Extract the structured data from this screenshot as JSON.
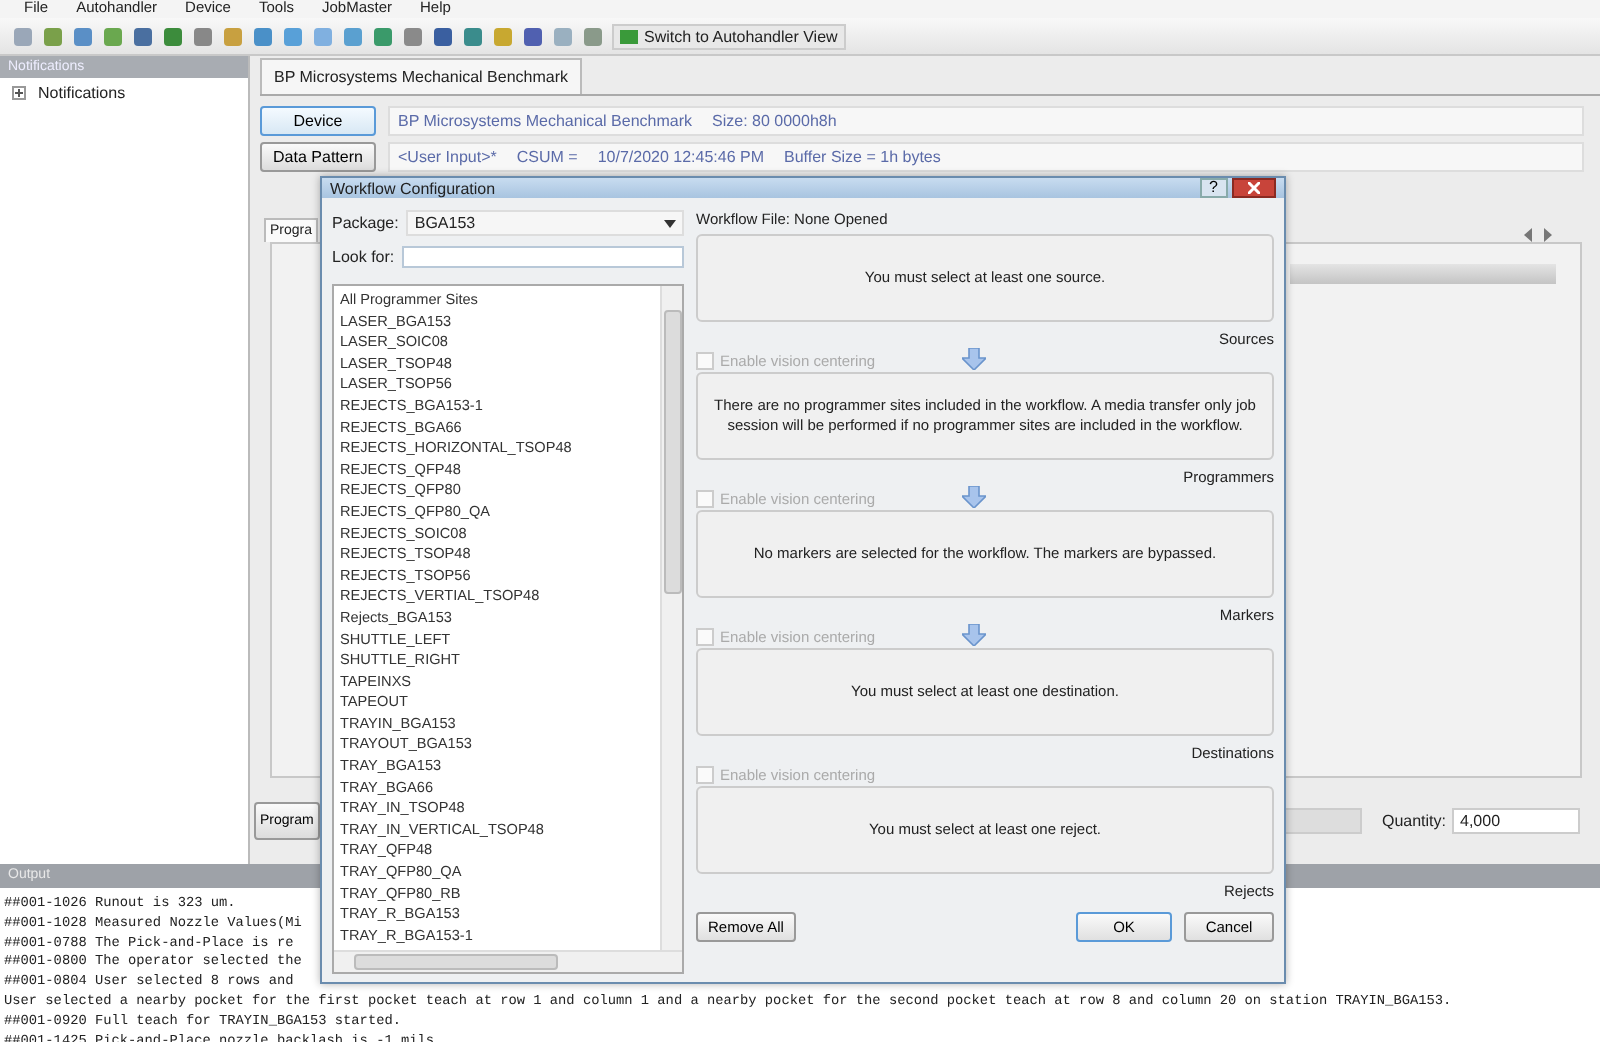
{
  "menu": [
    "File",
    "Autohandler",
    "Device",
    "Tools",
    "JobMaster",
    "Help"
  ],
  "toolbar": {
    "button_label": "Switch to Autohandler View"
  },
  "notifications": {
    "title": "Notifications",
    "items": [
      {
        "label": "Notifications",
        "expanded": false
      }
    ]
  },
  "document_tab": {
    "label": "BP Microsystems Mechanical Benchmark"
  },
  "device_row": {
    "button": "Device",
    "info": [
      "BP Microsystems Mechanical Benchmark",
      "Size: 80 0000h8h"
    ]
  },
  "pattern_row": {
    "button": "Data Pattern",
    "info": [
      "<User Input>*",
      "CSUM =",
      "10/7/2020 12:45:46 PM",
      "Buffer Size = 1h bytes"
    ]
  },
  "program_tab": "Progra",
  "program_button": "Program",
  "quantity": {
    "label": "Quantity:",
    "value": "4,000"
  },
  "output": {
    "title": "Output",
    "lines": [
      {
        "text": "##001-1026 Runout is 323 um."
      },
      {
        "text": "##001-1028 Measured Nozzle Values(Mi"
      },
      {
        "text": "##001-0788 The Pick-and-Place is re"
      },
      {
        "text": "##001-0800 The operator selected the"
      },
      {
        "text": "##001-0804 User selected 8 rows and"
      },
      {
        "text": "User selected a nearby pocket for the first pocket teach at row 1 and column 1 and a nearby pocket for the second pocket teach at row 8 and column 20 on station TRAYIN_BGA153."
      },
      {
        "text": "##001-0920 Full teach for TRAYIN_BGA153 started."
      },
      {
        "text": "##001-1425 Pick-and-Place nozzle backlash is -1 mils"
      }
    ]
  },
  "dialog": {
    "title": "Workflow Configuration",
    "help": "?",
    "package": {
      "label": "Package:",
      "value": "BGA153"
    },
    "look_for": {
      "label": "Look for:"
    },
    "sites": [
      "All Programmer Sites",
      "LASER_BGA153",
      "LASER_SOIC08",
      "LASER_TSOP48",
      "LASER_TSOP56",
      "REJECTS_BGA153-1",
      "REJECTS_BGA66",
      "REJECTS_HORIZONTAL_TSOP48",
      "REJECTS_QFP48",
      "REJECTS_QFP80",
      "REJECTS_QFP80_QA",
      "REJECTS_SOIC08",
      "REJECTS_TSOP48",
      "REJECTS_TSOP56",
      "REJECTS_VERTIAL_TSOP48",
      "Rejects_BGA153",
      "SHUTTLE_LEFT",
      "SHUTTLE_RIGHT",
      "TAPEINXS",
      "TAPEOUT",
      "TRAYIN_BGA153",
      "TRAYOUT_BGA153",
      "TRAY_BGA153",
      "TRAY_BGA66",
      "TRAY_IN_TSOP48",
      "TRAY_IN_VERTICAL_TSOP48",
      "TRAY_QFP48",
      "TRAY_QFP80_QA",
      "TRAY_QFP80_RB",
      "TRAY_R_BGA153",
      "TRAY_R_BGA153-1"
    ],
    "workflow_file": "Workflow File: None Opened",
    "stages": [
      {
        "message": "You must select at least one source.",
        "label": "Sources",
        "vision": {
          "label": "Enable vision centering",
          "checked": false,
          "disabled": true
        },
        "arrow": true
      },
      {
        "message": "There are no programmer sites included in the workflow. A media transfer only job session will be performed if no programmer sites are included in the workflow.",
        "label": "Programmers",
        "vision": {
          "label": "Enable vision centering",
          "checked": false,
          "disabled": true
        },
        "arrow": true
      },
      {
        "message": "No markers are selected for the workflow. The markers are bypassed.",
        "label": "Markers",
        "vision": {
          "label": "Enable vision centering",
          "checked": false,
          "disabled": true
        },
        "arrow": true
      },
      {
        "message": "You must select at least one destination.",
        "label": "Destinations",
        "vision": {
          "label": "Enable vision centering",
          "checked": false,
          "disabled": true
        },
        "arrow": false
      },
      {
        "message": "You must select at least one reject.",
        "label": "Rejects"
      }
    ],
    "buttons": {
      "remove_all": "Remove All",
      "ok": "OK",
      "cancel": "Cancel"
    }
  }
}
